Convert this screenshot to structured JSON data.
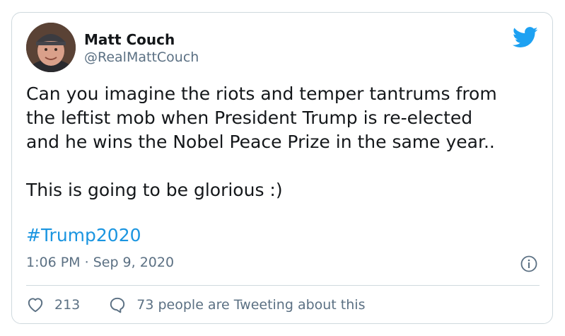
{
  "author": {
    "name": "Matt Couch",
    "handle": "@RealMattCouch"
  },
  "tweet": {
    "line_block_1": "Can you imagine the riots and temper tantrums from\nthe leftist mob when President Trump is re-elected\nand he wins the Nobel Peace Prize in the same year..",
    "line_block_2": "This is going to be glorious :)",
    "hashtag": "#Trump2020"
  },
  "meta": {
    "time": "1:06 PM",
    "separator": "·",
    "date": "Sep 9, 2020"
  },
  "footer": {
    "likes": "213",
    "conversation": "73 people are Tweeting about this"
  },
  "icons": {
    "brand": "twitter-bird-icon",
    "info": "info-icon",
    "like": "heart-icon",
    "reply": "speech-bubble-icon"
  },
  "colors": {
    "link": "#1b95e0",
    "brand": "#1da1f2",
    "muted": "#5b7083",
    "text": "#14171a",
    "border": "#cfd9de"
  }
}
